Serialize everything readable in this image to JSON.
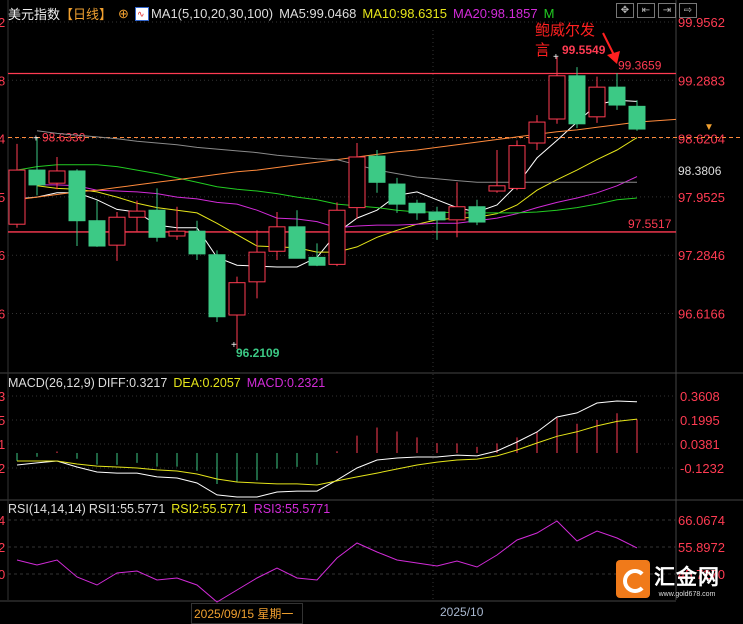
{
  "header": {
    "symbol": "美元指数",
    "period": "【日线】",
    "ma_set": "MA1(5,10,20,30,100)",
    "ma5": "MA5:99.0468",
    "ma10": "MA10:98.6315",
    "ma20": "MA20:98.1857",
    "ma_more": "M",
    "toolbar": [
      "✥",
      "⇤",
      "⇥",
      "⇨"
    ]
  },
  "colors": {
    "up": "#ff3b52",
    "down": "#3cc985",
    "ma5": "#ffffff",
    "ma10": "#e5e51a",
    "ma20": "#d22bd8",
    "ma30": "#22cc22",
    "ma100": "#ff8a3c",
    "gray": "#8a8a8a",
    "axis": "#ff3b52"
  },
  "left_axis_fragments": {
    "price": [
      "2",
      "8",
      "4",
      "5",
      "6",
      "6"
    ],
    "macd": [
      "3",
      "5",
      "1",
      "2"
    ],
    "rsi": [
      "4",
      "2",
      "0"
    ]
  },
  "chart_data": [
    {
      "type": "candlestick",
      "title": "美元指数 日线",
      "y_ticks": [
        99.9562,
        99.2883,
        98.6204,
        97.9525,
        97.2846,
        96.6166
      ],
      "ylim": [
        96.0,
        100.2
      ],
      "candles": [
        [
          97.64,
          98.56,
          97.6,
          98.26
        ],
        [
          98.26,
          98.633,
          97.97,
          98.09
        ],
        [
          98.11,
          98.41,
          98.04,
          98.25
        ],
        [
          98.25,
          98.27,
          97.39,
          97.68
        ],
        [
          97.68,
          97.91,
          97.38,
          97.39
        ],
        [
          97.4,
          97.78,
          97.22,
          97.72
        ],
        [
          97.72,
          97.91,
          97.56,
          97.79
        ],
        [
          97.8,
          98.05,
          97.44,
          97.49
        ],
        [
          97.505,
          97.84,
          97.46,
          97.56
        ],
        [
          97.56,
          97.68,
          97.23,
          97.3
        ],
        [
          97.29,
          97.34,
          96.52,
          96.58
        ],
        [
          96.6,
          97.04,
          96.2109,
          96.97
        ],
        [
          96.98,
          97.57,
          96.79,
          97.32
        ],
        [
          97.33,
          97.78,
          97.23,
          97.61
        ],
        [
          97.61,
          97.8,
          97.25,
          97.25
        ],
        [
          97.26,
          97.42,
          97.16,
          97.17
        ],
        [
          97.18,
          97.89,
          97.16,
          97.8
        ],
        [
          97.83,
          98.57,
          97.7,
          98.41
        ],
        [
          98.42,
          98.49,
          98.0,
          98.12
        ],
        [
          98.1,
          98.17,
          97.77,
          97.87
        ],
        [
          97.88,
          97.92,
          97.69,
          97.77
        ],
        [
          97.78,
          97.84,
          97.46,
          97.69
        ],
        [
          97.69,
          98.12,
          97.49,
          97.84
        ],
        [
          97.84,
          97.92,
          97.63,
          97.665
        ],
        [
          98.02,
          98.49,
          98.0,
          98.08
        ],
        [
          98.05,
          98.6,
          98.03,
          98.54
        ],
        [
          98.57,
          98.89,
          98.49,
          98.81
        ],
        [
          98.845,
          99.5549,
          98.79,
          99.34
        ],
        [
          99.34,
          99.44,
          98.74,
          98.79
        ],
        [
          98.87,
          99.33,
          98.8,
          99.21
        ],
        [
          99.21,
          99.37,
          98.95,
          99.005
        ],
        [
          98.99,
          99.06,
          98.71,
          98.73
        ]
      ],
      "series": [
        {
          "name": "MA5",
          "color_key": "ma5",
          "values": [
            97.93,
            97.95,
            98.0,
            98.0,
            97.92,
            97.81,
            97.78,
            97.63,
            97.6,
            97.6,
            97.26,
            97.17,
            97.16,
            97.15,
            97.15,
            97.26,
            97.54,
            97.71,
            97.8,
            97.97,
            98.01,
            97.92,
            97.83,
            97.78,
            97.86,
            98.09,
            98.4,
            98.6,
            98.81,
            99.01,
            99.06,
            99.0468
          ]
        },
        {
          "name": "MA10",
          "color_key": "ma10",
          "values": [
            null,
            98.08,
            98.05,
            98.04,
            98.01,
            97.95,
            97.88,
            97.83,
            97.8,
            97.77,
            97.65,
            97.52,
            97.39,
            97.38,
            97.37,
            97.32,
            97.32,
            97.38,
            97.49,
            97.57,
            97.64,
            97.69,
            97.71,
            97.72,
            97.76,
            97.86,
            98.03,
            98.15,
            98.26,
            98.38,
            98.49,
            98.6315
          ]
        },
        {
          "name": "MA20",
          "color_key": "ma20",
          "values": [
            null,
            98.09,
            98.09,
            98.08,
            98.03,
            98.02,
            98.01,
            97.99,
            97.95,
            97.93,
            97.89,
            97.87,
            97.8,
            97.71,
            97.7,
            97.67,
            97.6,
            97.62,
            97.63,
            97.63,
            97.64,
            97.65,
            97.65,
            97.68,
            97.71,
            97.76,
            97.83,
            97.89,
            97.94,
            98.0,
            98.08,
            98.1857
          ]
        },
        {
          "name": "MA30",
          "color_key": "ma30",
          "values": [
            98.26,
            98.3,
            98.32,
            98.32,
            98.32,
            98.3,
            98.26,
            98.22,
            98.17,
            98.12,
            98.07,
            98.04,
            98.02,
            97.99,
            97.95,
            97.92,
            97.87,
            97.85,
            97.83,
            97.8,
            97.78,
            97.78,
            97.77,
            97.77,
            97.77,
            97.77,
            97.78,
            97.8,
            97.83,
            97.87,
            97.92,
            97.94
          ]
        },
        {
          "name": "MA100",
          "color_key": "ma100",
          "values": [
            97.92,
            97.95,
            97.98,
            98.01,
            98.03,
            98.06,
            98.09,
            98.12,
            98.15,
            98.18,
            98.21,
            98.24,
            98.26,
            98.29,
            98.32,
            98.35,
            98.38,
            98.41,
            98.44,
            98.47,
            98.49,
            98.52,
            98.55,
            98.58,
            98.61,
            98.64,
            98.67,
            98.7,
            98.72,
            98.75,
            98.78,
            98.81
          ]
        },
        {
          "name": "MA-gray",
          "color_key": "gray",
          "values": [
            null,
            98.71,
            98.68,
            98.66,
            98.64,
            98.62,
            98.59,
            98.57,
            98.55,
            98.52,
            98.5,
            98.48,
            98.46,
            98.43,
            98.41,
            98.39,
            98.38,
            98.32,
            98.26,
            98.22,
            98.18,
            98.16,
            98.14,
            98.12,
            98.12,
            98.12,
            98.12,
            98.12,
            98.12,
            98.12,
            98.12,
            98.12
          ]
        }
      ],
      "hlines": [
        {
          "value": 99.3659,
          "label": "99.3659",
          "style": "solid",
          "color_key": "up"
        },
        {
          "value": 97.5517,
          "label": "97.5517",
          "style": "solid",
          "color_key": "up"
        },
        {
          "value": 98.633,
          "label": "98.6330",
          "style": "dashed",
          "color_key": "ma100"
        }
      ],
      "current_price_label": "98.3806",
      "annotations": {
        "high_label": "99.5549",
        "low_label": "96.2109",
        "left_high_label": "98.6330",
        "event_text_line1": "鲍威尔发",
        "event_text_line2": "言"
      }
    },
    {
      "type": "line+bar",
      "title": "MACD(26,12,9)",
      "legend": {
        "title": "MACD(26,12,9)",
        "diff": "DIFF:0.3217",
        "dea": "DEA:0.2057",
        "macd": "MACD:0.2321"
      },
      "y_ticks": [
        0.3608,
        0.1995,
        0.0381,
        -0.1232
      ],
      "diff": [
        -0.103,
        -0.089,
        -0.076,
        -0.116,
        -0.15,
        -0.157,
        -0.157,
        -0.183,
        -0.19,
        -0.224,
        -0.304,
        -0.318,
        -0.318,
        -0.284,
        -0.278,
        -0.278,
        -0.204,
        -0.123,
        -0.069,
        -0.056,
        -0.049,
        -0.049,
        -0.036,
        -0.042,
        -0.009,
        0.052,
        0.119,
        0.22,
        0.247,
        0.314,
        0.327,
        0.3217
      ],
      "dea": [
        -0.076,
        -0.076,
        -0.076,
        -0.096,
        -0.11,
        -0.116,
        -0.123,
        -0.136,
        -0.143,
        -0.163,
        -0.197,
        -0.217,
        -0.224,
        -0.23,
        -0.23,
        -0.237,
        -0.21,
        -0.183,
        -0.157,
        -0.13,
        -0.103,
        -0.083,
        -0.069,
        -0.063,
        -0.042,
        -0.002,
        0.045,
        0.09,
        0.12,
        0.16,
        0.19,
        0.2057
      ],
      "macd": [
        -0.054,
        -0.026,
        0.01,
        -0.04,
        -0.08,
        -0.082,
        -0.068,
        -0.094,
        -0.094,
        -0.122,
        -0.214,
        -0.202,
        -0.188,
        -0.108,
        -0.096,
        -0.082,
        0.012,
        0.12,
        0.176,
        0.148,
        0.108,
        0.068,
        0.066,
        0.042,
        0.066,
        0.108,
        0.148,
        0.242,
        0.202,
        0.228,
        0.274,
        0.2321
      ]
    },
    {
      "type": "line",
      "title": "RSI(14,14,14)",
      "legend": {
        "title": "RSI(14,14,14)",
        "rsi1": "RSI1:55.5771",
        "rsi2": "RSI2:55.5771",
        "rsi3": "RSI3:55.5771"
      },
      "y_ticks": [
        66.0674,
        55.8972,
        45.727
      ],
      "values": [
        51.0,
        49.12,
        51.0,
        44.6,
        41.58,
        46.1,
        46.86,
        43.47,
        44.22,
        41.58,
        35.18,
        39.7,
        44.22,
        47.99,
        44.22,
        43.47,
        51.75,
        57.4,
        54.01,
        51.0,
        49.87,
        48.74,
        50.63,
        48.37,
        52.88,
        58.54,
        61.17,
        65.69,
        58.16,
        61.92,
        59.29,
        55.5771
      ]
    }
  ],
  "time_axis": {
    "selected_date": "2025/09/15 星期一",
    "month_label": "2025/10"
  },
  "logo": {
    "name": "汇金网",
    "url": "www.gold678.com"
  }
}
